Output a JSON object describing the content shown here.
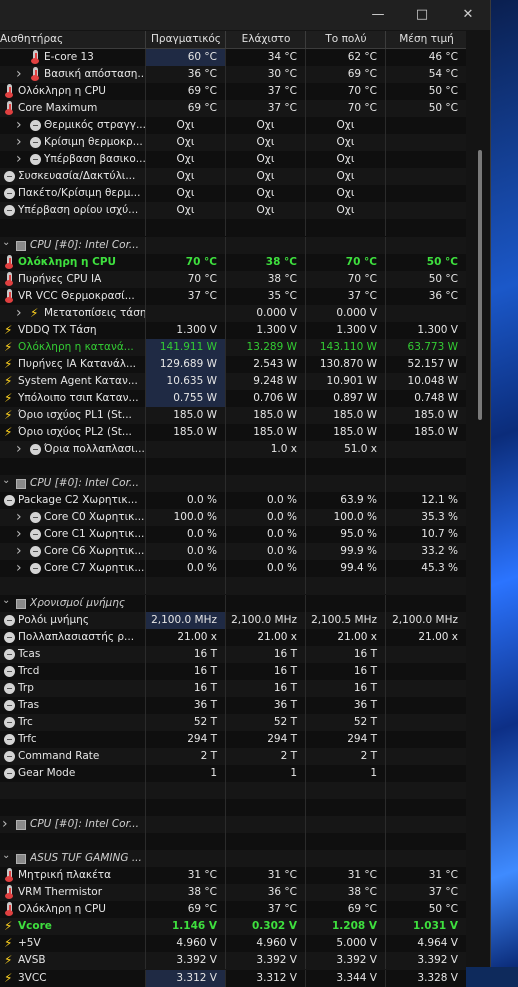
{
  "window": {
    "min_icon": "minimize-icon",
    "max_icon": "maximize-icon",
    "close_icon": "close-icon"
  },
  "columns": [
    "Αισθητήρας",
    "Πραγματικός",
    "Ελάχιστο",
    "Το πολύ",
    "Μέση τιμή"
  ],
  "rows": [
    {
      "type": "s",
      "indent": 1,
      "icon": "therm",
      "name": "E-core 13",
      "v": [
        "60 °C",
        "34 °C",
        "62 °C",
        "46 °C"
      ],
      "hl": true
    },
    {
      "type": "s",
      "indent": 1,
      "chev": true,
      "icon": "therm",
      "name": "Βασική απόσταση...",
      "v": [
        "36 °C",
        "30 °C",
        "69 °C",
        "54 °C"
      ]
    },
    {
      "type": "s",
      "indent": 0,
      "icon": "therm",
      "name": "Ολόκληρη η CPU",
      "v": [
        "69 °C",
        "37 °C",
        "70 °C",
        "50 °C"
      ]
    },
    {
      "type": "s",
      "indent": 0,
      "icon": "therm",
      "name": "Core Maximum",
      "v": [
        "69 °C",
        "37 °C",
        "70 °C",
        "50 °C"
      ]
    },
    {
      "type": "s",
      "indent": 1,
      "chev": true,
      "icon": "circ",
      "name": "Θερμικός στραγγ...",
      "v": [
        "Οχι",
        "Οχι",
        "Οχι",
        ""
      ]
    },
    {
      "type": "s",
      "indent": 1,
      "chev": true,
      "icon": "circ",
      "name": "Κρίσιμη θερμοκρ...",
      "v": [
        "Οχι",
        "Οχι",
        "Οχι",
        ""
      ]
    },
    {
      "type": "s",
      "indent": 1,
      "chev": true,
      "icon": "circ",
      "name": "Υπέρβαση βασικο...",
      "v": [
        "Οχι",
        "Οχι",
        "Οχι",
        ""
      ]
    },
    {
      "type": "s",
      "indent": 0,
      "icon": "circ",
      "name": "Συσκευασία/Δακτύλι...",
      "v": [
        "Οχι",
        "Οχι",
        "Οχι",
        ""
      ]
    },
    {
      "type": "s",
      "indent": 0,
      "icon": "circ",
      "name": "Πακέτο/Κρίσιμη θερμ...",
      "v": [
        "Οχι",
        "Οχι",
        "Οχι",
        ""
      ]
    },
    {
      "type": "s",
      "indent": 0,
      "icon": "circ",
      "name": "Υπέρβαση ορίου ισχύ...",
      "v": [
        "Οχι",
        "Οχι",
        "Οχι",
        ""
      ]
    },
    {
      "type": "blank"
    },
    {
      "type": "g",
      "name": "CPU [#0]: Intel Cor..."
    },
    {
      "type": "s",
      "indent": 0,
      "icon": "therm",
      "name": "Ολόκληρη η CPU",
      "v": [
        "70 °C",
        "38 °C",
        "70 °C",
        "50 °C"
      ],
      "green": true
    },
    {
      "type": "s",
      "indent": 0,
      "icon": "therm",
      "name": "Πυρήνες CPU IA",
      "v": [
        "70 °C",
        "38 °C",
        "70 °C",
        "50 °C"
      ]
    },
    {
      "type": "s",
      "indent": 0,
      "icon": "therm",
      "name": "VR VCC Θερμοκρασί...",
      "v": [
        "37 °C",
        "35 °C",
        "37 °C",
        "36 °C"
      ]
    },
    {
      "type": "s",
      "indent": 1,
      "chev": true,
      "icon": "bolt",
      "name": "Μετατοπίσεις τάσης",
      "v": [
        "",
        "0.000 V",
        "0.000 V",
        ""
      ]
    },
    {
      "type": "s",
      "indent": 0,
      "icon": "bolt",
      "name": "VDDQ TX Τάση",
      "v": [
        "1.300 V",
        "1.300 V",
        "1.300 V",
        "1.300 V"
      ]
    },
    {
      "type": "s",
      "indent": 0,
      "icon": "bolt",
      "name": "Ολόκληρη η κατανά...",
      "v": [
        "141.911 W",
        "13.289 W",
        "143.110 W",
        "63.773 W"
      ],
      "ggreen": true,
      "hl": true
    },
    {
      "type": "s",
      "indent": 0,
      "icon": "bolt",
      "name": "Πυρήνες IA Κατανάλ...",
      "v": [
        "129.689 W",
        "2.543 W",
        "130.870 W",
        "52.157 W"
      ],
      "hl": true
    },
    {
      "type": "s",
      "indent": 0,
      "icon": "bolt",
      "name": "System Agent Καταν...",
      "v": [
        "10.635 W",
        "9.248 W",
        "10.901 W",
        "10.048 W"
      ],
      "hl": true
    },
    {
      "type": "s",
      "indent": 0,
      "icon": "bolt",
      "name": "Υπόλοιπο τσιπ Καταν...",
      "v": [
        "0.755 W",
        "0.706 W",
        "0.897 W",
        "0.748 W"
      ],
      "hl": true
    },
    {
      "type": "s",
      "indent": 0,
      "icon": "bolt",
      "name": "Όριο ισχύος PL1 (St...",
      "v": [
        "185.0 W",
        "185.0 W",
        "185.0 W",
        "185.0 W"
      ]
    },
    {
      "type": "s",
      "indent": 0,
      "icon": "bolt",
      "name": "Όριο ισχύος PL2 (St...",
      "v": [
        "185.0 W",
        "185.0 W",
        "185.0 W",
        "185.0 W"
      ]
    },
    {
      "type": "s",
      "indent": 1,
      "chev": true,
      "icon": "circ",
      "name": "Όρια πολλαπλασι...",
      "v": [
        "",
        "1.0 x",
        "51.0 x",
        ""
      ]
    },
    {
      "type": "blank"
    },
    {
      "type": "g",
      "name": "CPU [#0]: Intel Cor..."
    },
    {
      "type": "s",
      "indent": 0,
      "icon": "circ",
      "name": "Package C2 Χωρητικ...",
      "v": [
        "0.0 %",
        "0.0 %",
        "63.9 %",
        "12.1 %"
      ]
    },
    {
      "type": "s",
      "indent": 1,
      "chev": true,
      "icon": "circ",
      "name": "Core C0 Χωρητικ...",
      "v": [
        "100.0 %",
        "0.0 %",
        "100.0 %",
        "35.3 %"
      ]
    },
    {
      "type": "s",
      "indent": 1,
      "chev": true,
      "icon": "circ",
      "name": "Core C1 Χωρητικ...",
      "v": [
        "0.0 %",
        "0.0 %",
        "95.0 %",
        "10.7 %"
      ]
    },
    {
      "type": "s",
      "indent": 1,
      "chev": true,
      "icon": "circ",
      "name": "Core C6 Χωρητικ...",
      "v": [
        "0.0 %",
        "0.0 %",
        "99.9 %",
        "33.2 %"
      ]
    },
    {
      "type": "s",
      "indent": 1,
      "chev": true,
      "icon": "circ",
      "name": "Core C7 Χωρητικ...",
      "v": [
        "0.0 %",
        "0.0 %",
        "99.4 %",
        "45.3 %"
      ]
    },
    {
      "type": "blank"
    },
    {
      "type": "g",
      "name": "Χρονισμοί μνήμης"
    },
    {
      "type": "s",
      "indent": 0,
      "icon": "circ",
      "name": "Ρολόι μνήμης",
      "v": [
        "2,100.0 MHz",
        "2,100.0 MHz",
        "2,100.5 MHz",
        "2,100.0 MHz"
      ],
      "hl": true
    },
    {
      "type": "s",
      "indent": 0,
      "icon": "circ",
      "name": "Πολλαπλασιαστής ρ...",
      "v": [
        "21.00 x",
        "21.00 x",
        "21.00 x",
        "21.00 x"
      ]
    },
    {
      "type": "s",
      "indent": 0,
      "icon": "circ",
      "name": "Tcas",
      "v": [
        "16 T",
        "16 T",
        "16 T",
        ""
      ]
    },
    {
      "type": "s",
      "indent": 0,
      "icon": "circ",
      "name": "Trcd",
      "v": [
        "16 T",
        "16 T",
        "16 T",
        ""
      ]
    },
    {
      "type": "s",
      "indent": 0,
      "icon": "circ",
      "name": "Trp",
      "v": [
        "16 T",
        "16 T",
        "16 T",
        ""
      ]
    },
    {
      "type": "s",
      "indent": 0,
      "icon": "circ",
      "name": "Tras",
      "v": [
        "36 T",
        "36 T",
        "36 T",
        ""
      ]
    },
    {
      "type": "s",
      "indent": 0,
      "icon": "circ",
      "name": "Trc",
      "v": [
        "52 T",
        "52 T",
        "52 T",
        ""
      ]
    },
    {
      "type": "s",
      "indent": 0,
      "icon": "circ",
      "name": "Trfc",
      "v": [
        "294 T",
        "294 T",
        "294 T",
        ""
      ]
    },
    {
      "type": "s",
      "indent": 0,
      "icon": "circ",
      "name": "Command Rate",
      "v": [
        "2 T",
        "2 T",
        "2 T",
        ""
      ]
    },
    {
      "type": "s",
      "indent": 0,
      "icon": "circ",
      "name": "Gear Mode",
      "v": [
        "1",
        "1",
        "1",
        ""
      ]
    },
    {
      "type": "blank"
    },
    {
      "type": "blank"
    },
    {
      "type": "g",
      "chev": true,
      "name": "CPU [#0]: Intel Cor..."
    },
    {
      "type": "blank"
    },
    {
      "type": "g",
      "name": "ASUS TUF GAMING ..."
    },
    {
      "type": "s",
      "indent": 0,
      "icon": "therm",
      "name": "Μητρική πλακέτα",
      "v": [
        "31 °C",
        "31 °C",
        "31 °C",
        "31 °C"
      ]
    },
    {
      "type": "s",
      "indent": 0,
      "icon": "therm",
      "name": "VRM Thermistor",
      "v": [
        "38 °C",
        "36 °C",
        "38 °C",
        "37 °C"
      ]
    },
    {
      "type": "s",
      "indent": 0,
      "icon": "therm",
      "name": "Ολόκληρη η CPU",
      "v": [
        "69 °C",
        "37 °C",
        "69 °C",
        "50 °C"
      ]
    },
    {
      "type": "s",
      "indent": 0,
      "icon": "bolt",
      "name": "Vcore",
      "v": [
        "1.146 V",
        "0.302 V",
        "1.208 V",
        "1.031 V"
      ],
      "green": true
    },
    {
      "type": "s",
      "indent": 0,
      "icon": "bolt",
      "name": "+5V",
      "v": [
        "4.960 V",
        "4.960 V",
        "5.000 V",
        "4.964 V"
      ]
    },
    {
      "type": "s",
      "indent": 0,
      "icon": "bolt",
      "name": "AVSB",
      "v": [
        "3.392 V",
        "3.392 V",
        "3.392 V",
        "3.392 V"
      ]
    },
    {
      "type": "s",
      "indent": 0,
      "icon": "bolt",
      "name": "3VCC",
      "v": [
        "3.312 V",
        "3.312 V",
        "3.344 V",
        "3.328 V"
      ],
      "hl": true
    }
  ]
}
